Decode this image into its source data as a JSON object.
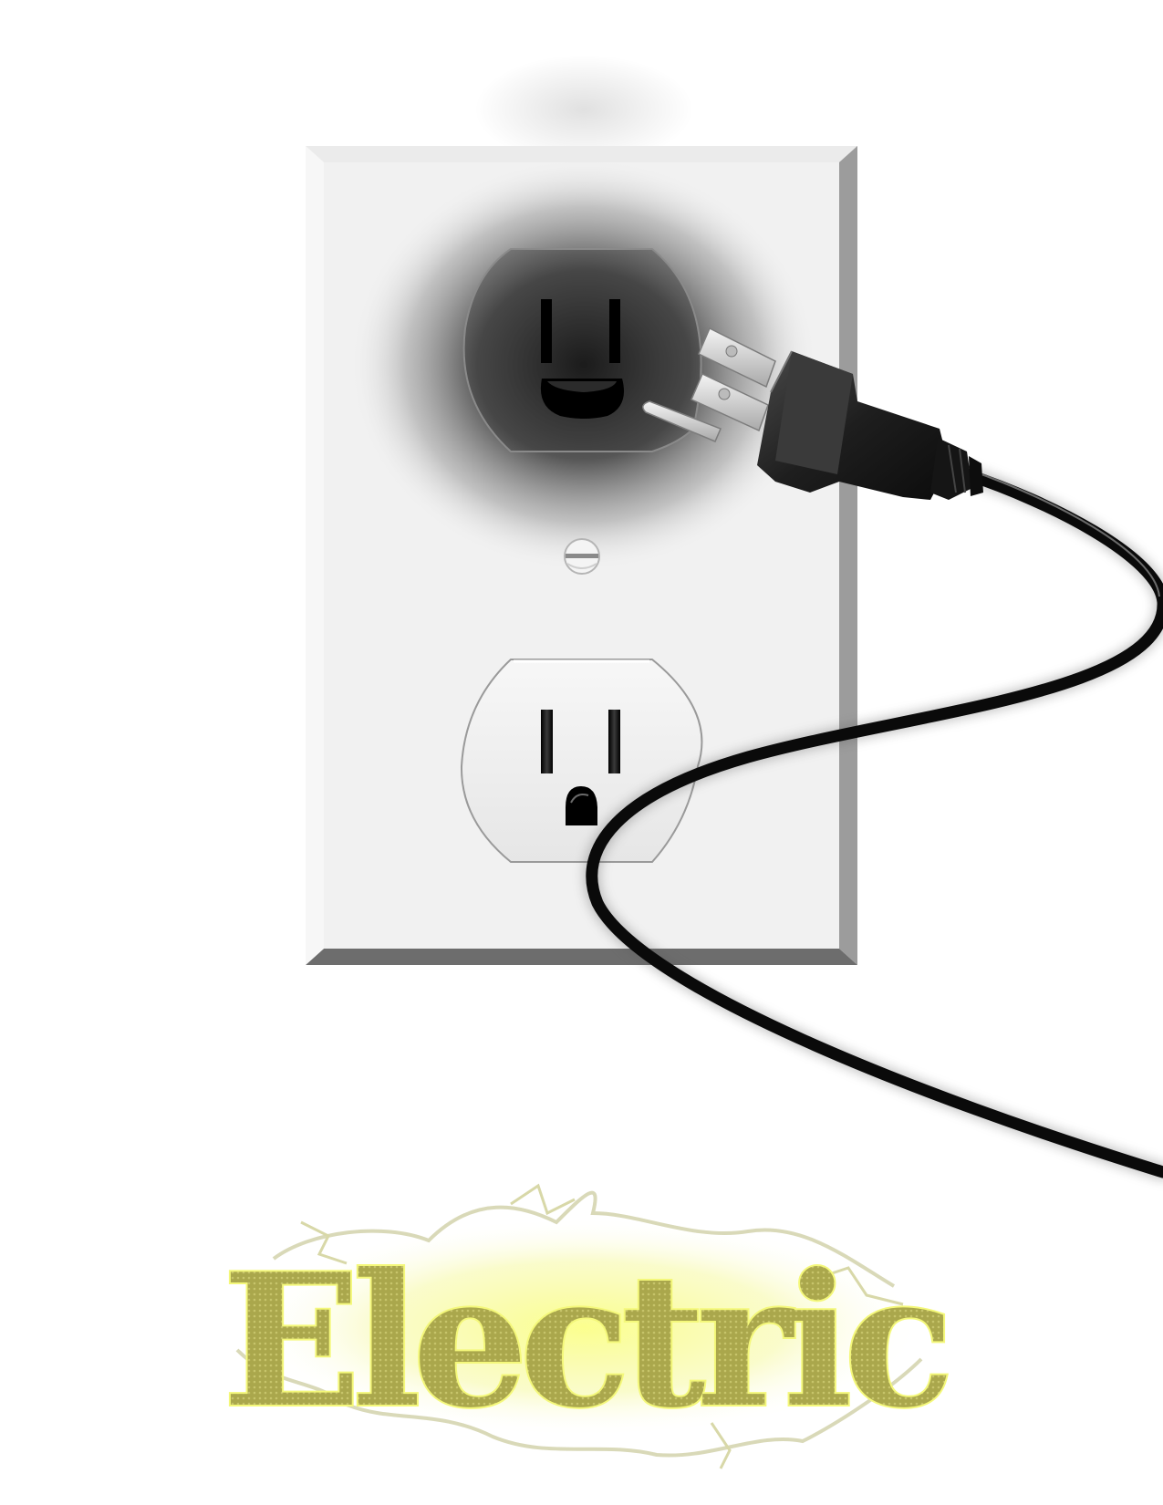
{
  "title": {
    "text": "Electric"
  },
  "colors": {
    "background": "#ffffff",
    "plate": "#f1f1f1",
    "plate_bevel_dark": "#9a9a9a",
    "plate_bevel_light": "#e4e4e4",
    "cord": "#0a0a0a",
    "plug_body": "#2a2a2a",
    "prongs": "#d8d8d8",
    "title_fill": "#a9a64a",
    "title_glow": "#f3f77a"
  },
  "icons": {
    "plate": "outlet-wall-plate-icon",
    "receptacle_top": "receptacle-icon",
    "receptacle_bottom": "receptacle-icon",
    "screw": "screw-icon",
    "plug": "plug-icon",
    "cord": "power-cord-icon"
  }
}
